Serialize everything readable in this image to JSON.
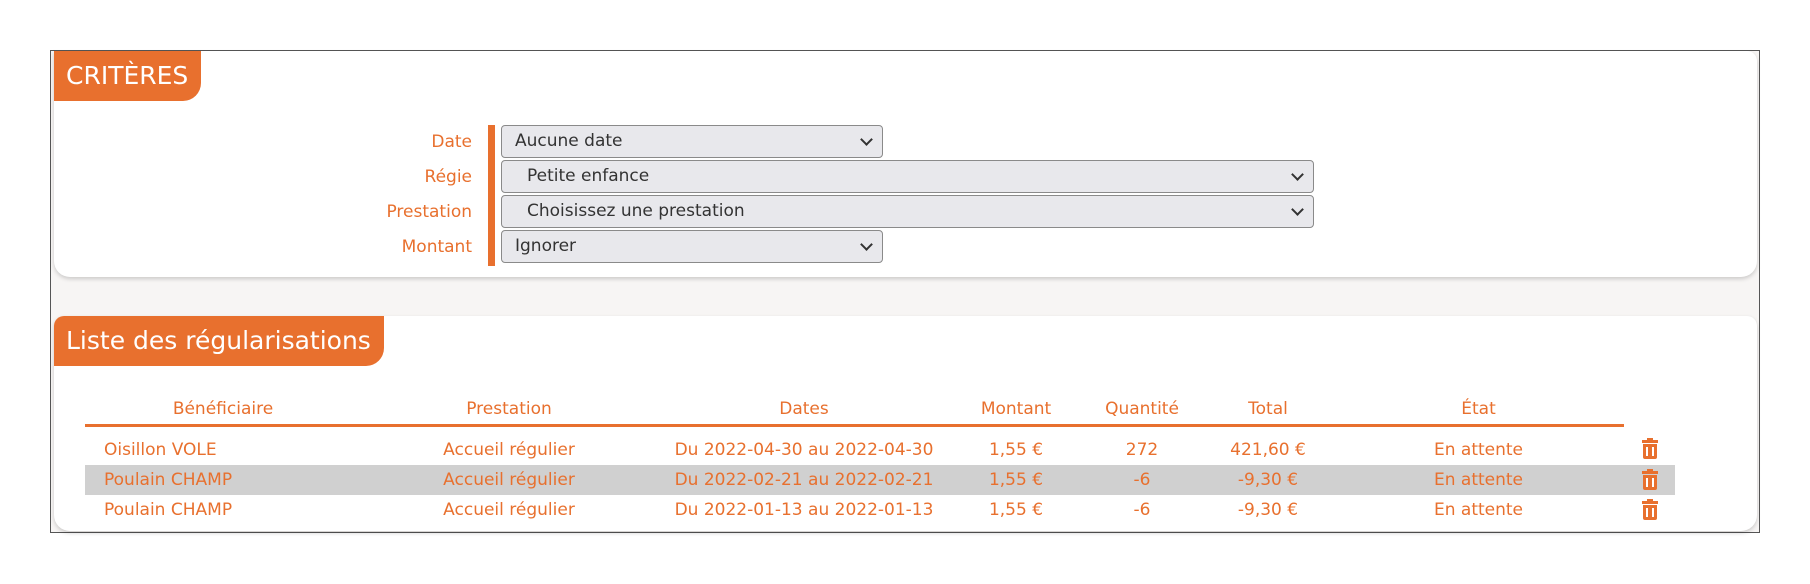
{
  "criteria": {
    "title": "CRITÈRES",
    "date_label": "Date",
    "regie_label": "Régie",
    "prestation_label": "Prestation",
    "montant_label": "Montant",
    "date_value": "Aucune date",
    "regie_value": "Petite enfance",
    "prestation_value": "Choisissez une prestation",
    "montant_value": "Ignorer"
  },
  "list": {
    "title": "Liste des régularisations",
    "columns": [
      "Bénéficiaire",
      "Prestation",
      "Dates",
      "Montant",
      "Quantité",
      "Total",
      "État"
    ],
    "rows": [
      {
        "beneficiaire": "Oisillon VOLE",
        "prestation": "Accueil régulier",
        "dates": "Du 2022-04-30 au 2022-04-30",
        "montant": "1,55 €",
        "quantite": "272",
        "total": "421,60 €",
        "etat": "En attente"
      },
      {
        "beneficiaire": "Poulain CHAMP",
        "prestation": "Accueil régulier",
        "dates": "Du 2022-02-21 au 2022-02-21",
        "montant": "1,55 €",
        "quantite": "-6",
        "total": "-9,30 €",
        "etat": "En attente"
      },
      {
        "beneficiaire": "Poulain CHAMP",
        "prestation": "Accueil régulier",
        "dates": "Du 2022-01-13 au 2022-01-13",
        "montant": "1,55 €",
        "quantite": "-6",
        "total": "-9,30 €",
        "etat": "En attente"
      }
    ],
    "highlighted_row": 1,
    "row_action_icon": "trash-icon"
  },
  "colors": {
    "accent": "#e8702e",
    "row_highlight": "#d0d0d0",
    "select_bg": "#e8e8ec"
  }
}
